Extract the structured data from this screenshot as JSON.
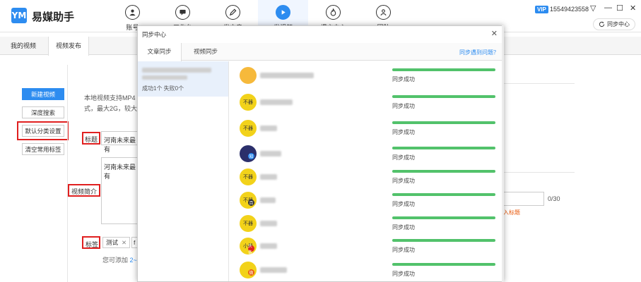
{
  "app": {
    "logo_text": "YM",
    "title": "易媒助手"
  },
  "nav": [
    {
      "label": "账号",
      "icon": "person-icon",
      "active": false
    },
    {
      "label": "工作台",
      "icon": "chat-icon",
      "active": false
    },
    {
      "label": "发文章",
      "icon": "pen-icon",
      "active": false
    },
    {
      "label": "发视频",
      "icon": "play-icon",
      "active": true
    },
    {
      "label": "爆文中心",
      "icon": "fire-icon",
      "active": false
    },
    {
      "label": "团队",
      "icon": "team-icon",
      "active": false
    }
  ],
  "user": {
    "vip_badge": "VIP",
    "phone": "15549423558"
  },
  "window": {
    "menu": "▽",
    "minimize": "—",
    "maximize": "☐",
    "close": "✕"
  },
  "sync_center_button": "同步中心",
  "page_tabs": [
    {
      "label": "我的视频",
      "active": false
    },
    {
      "label": "视频发布",
      "active": true
    }
  ],
  "left_buttons": [
    "新建视频",
    "深度搜索",
    "默认分类设置",
    "清空常用标签"
  ],
  "form": {
    "hint_line1": "本地视频支持MP4",
    "hint_line2": "式，最大2G，较大",
    "title_label": "标题",
    "title_value": "河南未来最有",
    "desc_label": "视频简介",
    "desc_value": "河南未来最有",
    "tag_label": "标签",
    "tag_chip": "测试",
    "tag_chip_remove": "✕",
    "tag_chip2": "f",
    "add_hint_prefix": "您可添加",
    "add_hint_value": "2~"
  },
  "right_panel": {
    "count": "0/30",
    "warning": "入标题"
  },
  "modal": {
    "title": "同步中心",
    "close": "✕",
    "tabs": [
      {
        "label": "文章同步",
        "active": true
      },
      {
        "label": "视频同步",
        "active": false
      }
    ],
    "help_link": "同步遇到问题？",
    "article_status": "成功1个 失败0个",
    "rows": [
      {
        "avatar_text": "",
        "avatar_style": "face",
        "badge": "",
        "badge_color": "",
        "progress": 1.0,
        "status": "同步成功"
      },
      {
        "avatar_text": "不器",
        "avatar_style": "yellow",
        "badge": "",
        "badge_color": "",
        "progress": 1.0,
        "status": "同步成功"
      },
      {
        "avatar_text": "不器",
        "avatar_style": "yellow",
        "badge": "",
        "badge_color": "",
        "progress": 1.0,
        "status": "同步成功"
      },
      {
        "avatar_text": "",
        "avatar_style": "dark",
        "badge": "知",
        "badge_color": "#2d8cf0",
        "progress": 1.0,
        "status": "同步成功"
      },
      {
        "avatar_text": "不器",
        "avatar_style": "yellow",
        "badge": "",
        "badge_color": "",
        "progress": 1.0,
        "status": "同步成功"
      },
      {
        "avatar_text": "不器",
        "avatar_style": "yellow",
        "badge": "百",
        "badge_color": "#333333",
        "progress": 1.0,
        "status": "同步成功"
      },
      {
        "avatar_text": "不器",
        "avatar_style": "yellow",
        "badge": "",
        "badge_color": "",
        "progress": 1.0,
        "status": "同步成功"
      },
      {
        "avatar_text": "小器",
        "avatar_style": "yellow",
        "badge": "头条",
        "badge_color": "#e02020",
        "progress": 1.0,
        "status": "同步成功"
      },
      {
        "avatar_text": "",
        "avatar_style": "yellow",
        "badge": "微",
        "badge_color": "#e8590c",
        "progress": 1.0,
        "status": "同步成功"
      }
    ]
  },
  "colors": {
    "accent": "#2d8cf0",
    "success": "#52c26b",
    "highlight": "#e02020"
  }
}
